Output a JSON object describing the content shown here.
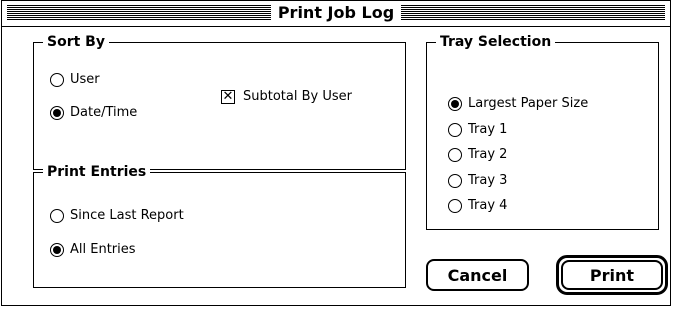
{
  "window": {
    "title": "Print Job Log"
  },
  "sort_by": {
    "label": "Sort By",
    "options": [
      {
        "label": "User",
        "selected": false
      },
      {
        "label": "Date/Time",
        "selected": true
      }
    ],
    "subtotal": {
      "label": "Subtotal By User",
      "checked": true,
      "mark": "✕"
    }
  },
  "print_entries": {
    "label": "Print Entries",
    "options": [
      {
        "label": "Since Last Report",
        "selected": false
      },
      {
        "label": "All Entries",
        "selected": true
      }
    ]
  },
  "tray_selection": {
    "label": "Tray Selection",
    "options": [
      {
        "label": "Largest Paper Size",
        "selected": true
      },
      {
        "label": "Tray 1",
        "selected": false
      },
      {
        "label": "Tray 2",
        "selected": false
      },
      {
        "label": "Tray 3",
        "selected": false
      },
      {
        "label": "Tray 4",
        "selected": false
      }
    ]
  },
  "buttons": {
    "cancel": "Cancel",
    "print": "Print"
  }
}
